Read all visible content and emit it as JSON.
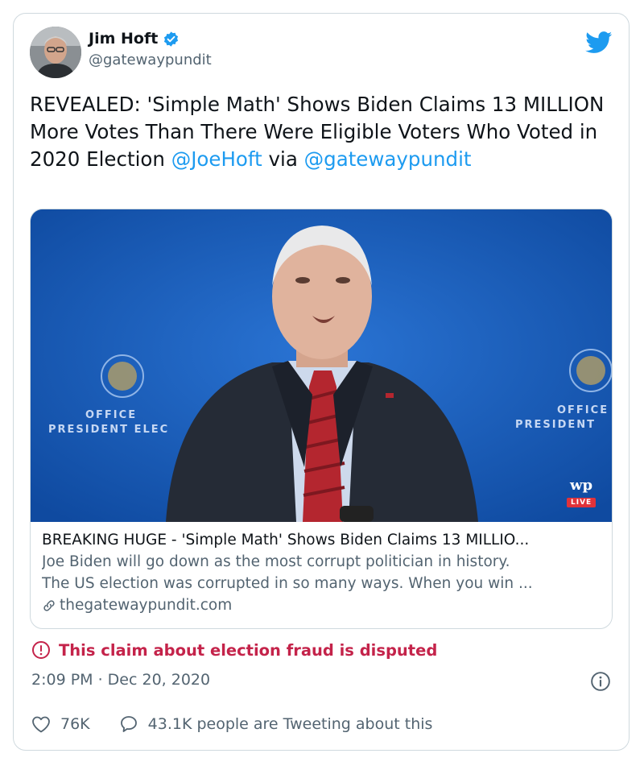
{
  "author": {
    "name": "Jim Hoft",
    "handle": "@gatewaypundit"
  },
  "tweet": {
    "text_main": "REVEALED: 'Simple Math' Shows Biden Claims 13 MILLION More Votes Than There Were Eligible Voters Who Voted in 2020 Election",
    "mention1": "@JoeHoft",
    "via": "via",
    "mention2": "@gatewaypundit"
  },
  "preview_image": {
    "backdrop_left_1": "OFFICE",
    "backdrop_left_2": "PRESIDENT ELEC",
    "backdrop_right_1": "OFFICE",
    "backdrop_right_2": "PRESIDENT",
    "watermark_logo": "wp",
    "live_badge": "LIVE"
  },
  "link_card": {
    "title": "BREAKING HUGE - 'Simple Math' Shows Biden Claims 13 MILLIO...",
    "description_line1": "Joe Biden will go down as the most corrupt politician in history.",
    "description_line2": "The US election was corrupted in so many ways. When you win ...",
    "domain": "thegatewaypundit.com"
  },
  "dispute_label": "This claim about election fraud is disputed",
  "timestamp": "2:09 PM · Dec 20, 2020",
  "metrics": {
    "likes": "76K",
    "talking": "43.1K people are Tweeting about this"
  },
  "colors": {
    "accent": "#1d9bf0",
    "dispute": "#c4234a",
    "secondary_text": "#536471",
    "border": "#cfd9de",
    "backdrop_blue": "#1558b6"
  },
  "icons": [
    "verified-badge-icon",
    "twitter-bird-icon",
    "link-icon",
    "exclamation-circle-icon",
    "info-icon",
    "heart-icon",
    "speech-bubble-icon"
  ]
}
